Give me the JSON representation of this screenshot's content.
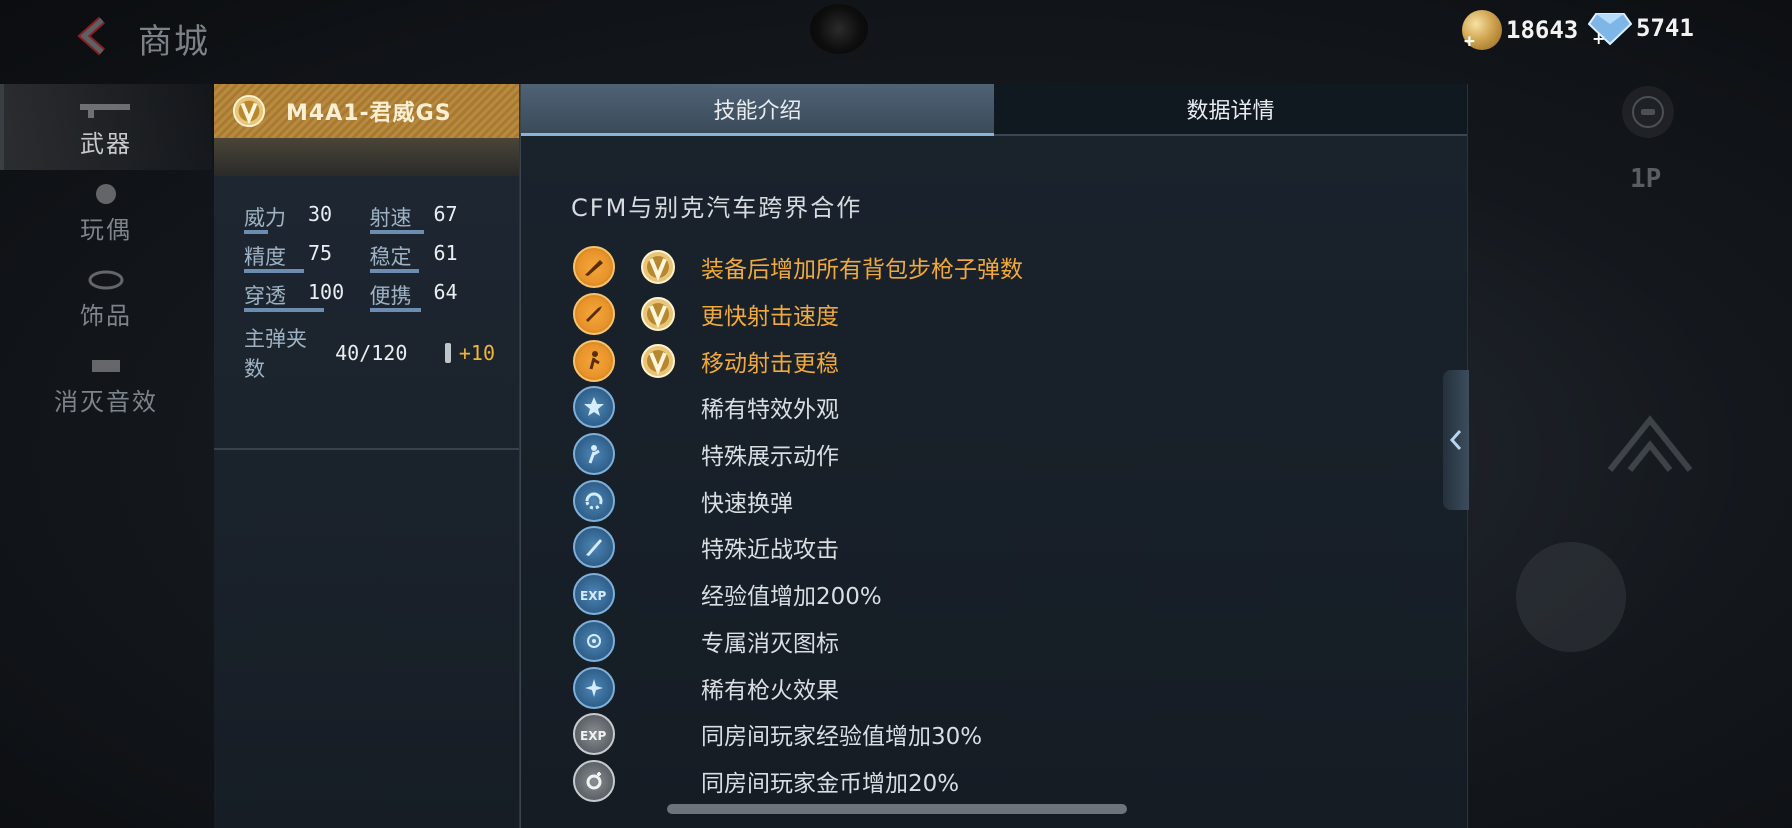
{
  "header": {
    "title": "商城",
    "gold_amount": "18643",
    "gem_amount": "5741"
  },
  "left_nav": {
    "items": [
      {
        "label": "武器",
        "active": true
      },
      {
        "label": "玩偶",
        "active": false
      },
      {
        "label": "饰品",
        "active": false
      },
      {
        "label": "消灭音效",
        "active": false
      }
    ]
  },
  "weapon": {
    "name": "M4A1-君威GS",
    "stats": [
      {
        "label": "威力",
        "value": "30",
        "level": 0.3
      },
      {
        "label": "射速",
        "value": "67",
        "level": 0.67
      },
      {
        "label": "精度",
        "value": "75",
        "level": 0.75
      },
      {
        "label": "稳定",
        "value": "61",
        "level": 0.61
      },
      {
        "label": "穿透",
        "value": "100",
        "level": 1.0
      },
      {
        "label": "便携",
        "value": "64",
        "level": 0.64
      }
    ],
    "ammo_label": "主弹夹数",
    "ammo_value": "40/120",
    "ammo_bonus": "+10"
  },
  "tabs": [
    {
      "label": "技能介绍",
      "active": true
    },
    {
      "label": "数据详情",
      "active": false
    }
  ],
  "skills": {
    "subtitle": "CFM与别克汽车跨界合作",
    "features": [
      {
        "text": "装备后增加所有背包步枪子弹数",
        "style": "gold",
        "vip": true,
        "icon": "rifle-icon"
      },
      {
        "text": "更快射击速度",
        "style": "gold",
        "vip": true,
        "icon": "bullet-icon"
      },
      {
        "text": "移动射击更稳",
        "style": "gold",
        "vip": true,
        "icon": "running-shooter-icon"
      },
      {
        "text": "稀有特效外观",
        "style": "blue",
        "vip": false,
        "icon": "star-icon"
      },
      {
        "text": "特殊展示动作",
        "style": "blue",
        "vip": false,
        "icon": "character-pose-icon"
      },
      {
        "text": "快速换弹",
        "style": "blue",
        "vip": false,
        "icon": "reload-icon"
      },
      {
        "text": "特殊近战攻击",
        "style": "blue",
        "vip": false,
        "icon": "knife-icon"
      },
      {
        "text": "经验值增加200%",
        "style": "blue",
        "vip": false,
        "icon": "exp-icon"
      },
      {
        "text": "专属消灭图标",
        "style": "blue",
        "vip": false,
        "icon": "kill-badge-icon"
      },
      {
        "text": "稀有枪火效果",
        "style": "blue",
        "vip": false,
        "icon": "muzzle-flash-icon"
      },
      {
        "text": "同房间玩家经验值增加30%",
        "style": "grey",
        "vip": false,
        "icon": "room-exp-icon"
      },
      {
        "text": "同房间玩家金币增加20%",
        "style": "grey",
        "vip": false,
        "icon": "room-gold-icon"
      }
    ]
  },
  "right_side": {
    "view_label": "1P"
  },
  "colors": {
    "gold_text": "#f0a93a",
    "tab_active": "#4f6375",
    "card_header": "#b98a3e"
  }
}
